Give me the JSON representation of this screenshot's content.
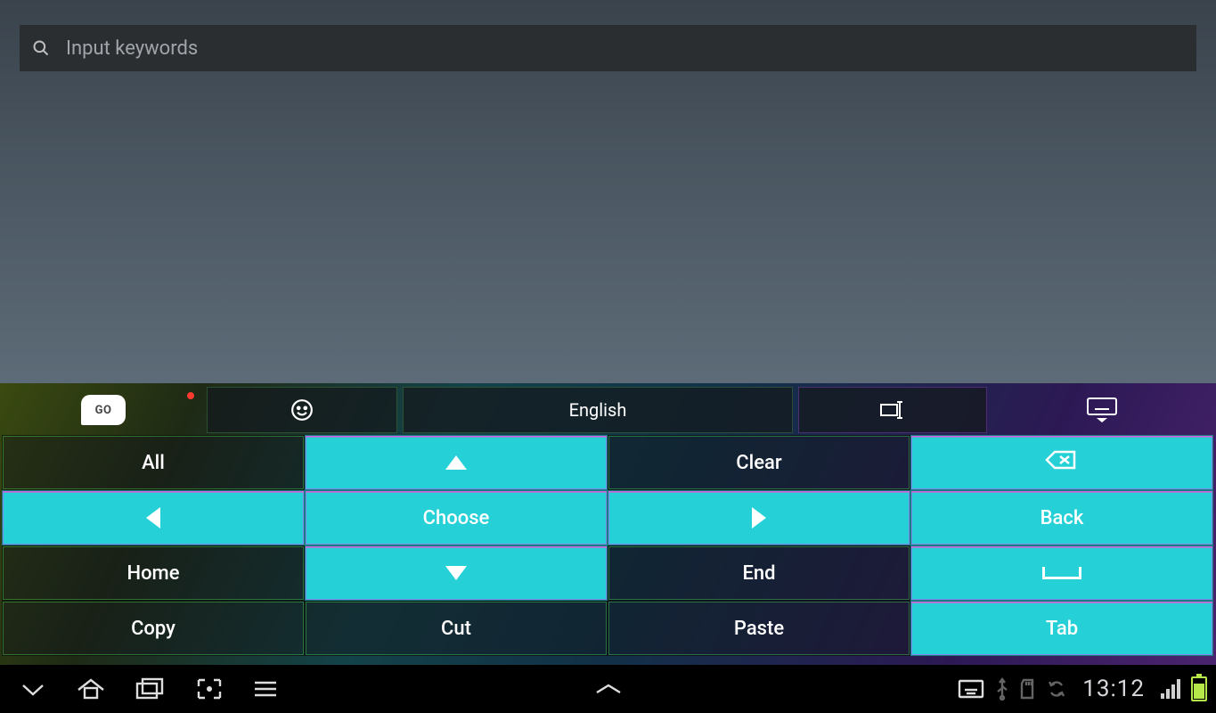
{
  "search": {
    "placeholder": "Input keywords",
    "value": ""
  },
  "keyboard": {
    "top": {
      "go": "GO",
      "language": "English"
    },
    "keys": {
      "all": "All",
      "clear": "Clear",
      "choose": "Choose",
      "back": "Back",
      "home": "Home",
      "end": "End",
      "copy": "Copy",
      "cut": "Cut",
      "paste": "Paste",
      "tab": "Tab"
    },
    "key_grid_layout": [
      [
        "all",
        "arrow-up",
        "clear",
        "backspace"
      ],
      [
        "arrow-left",
        "choose",
        "arrow-right",
        "back"
      ],
      [
        "home",
        "arrow-down",
        "end",
        "space"
      ],
      [
        "copy",
        "cut",
        "paste",
        "tab"
      ]
    ],
    "highlighted_keys": [
      "arrow-up",
      "arrow-down",
      "arrow-left",
      "arrow-right",
      "choose",
      "back",
      "backspace",
      "space",
      "tab"
    ],
    "accent_cyan": "#25d0d6"
  },
  "status": {
    "time": "13:12"
  }
}
